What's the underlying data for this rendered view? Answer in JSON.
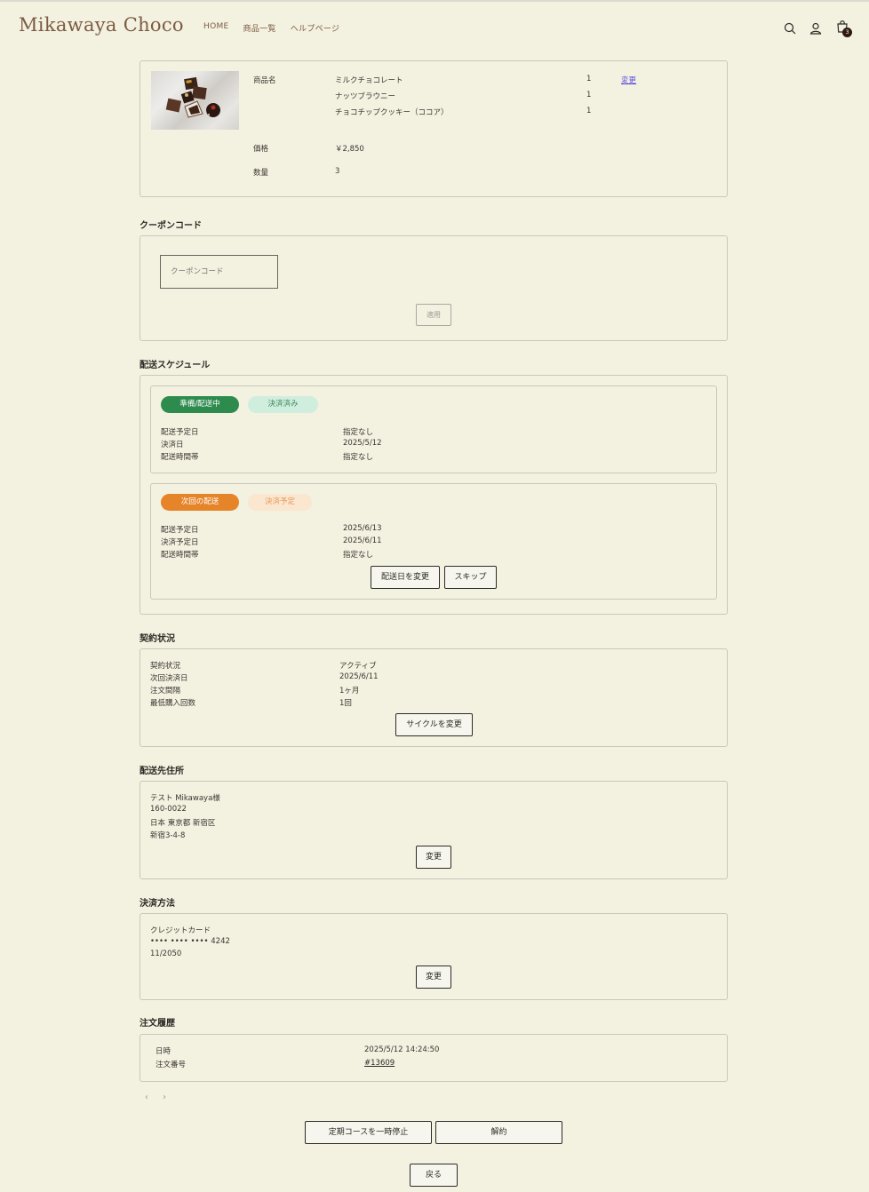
{
  "header": {
    "logo": "Mikawaya Choco",
    "nav": [
      "HOME",
      "商品一覧",
      "ヘルプページ"
    ],
    "cart_count": "3",
    "icons": [
      "search-icon",
      "user-icon",
      "cart-icon"
    ]
  },
  "product": {
    "name_label": "商品名",
    "items": [
      {
        "name": "ミルクチョコレート",
        "qty": "1"
      },
      {
        "name": "ナッツブラウニー",
        "qty": "1"
      },
      {
        "name": "チョコチップクッキー（ココア）",
        "qty": "1"
      }
    ],
    "change_link": "変更",
    "price_label": "価格",
    "price_value": "￥2,850",
    "quantity_label": "数量",
    "quantity_value": "3"
  },
  "coupon": {
    "title": "クーポンコード",
    "placeholder": "クーポンコード",
    "apply_label": "適用"
  },
  "schedule": {
    "title": "配送スケジュール",
    "current": {
      "status_badge": "準備/配送中",
      "payment_badge": "決済済み",
      "rows": [
        {
          "label": "配送予定日",
          "value": "指定なし"
        },
        {
          "label": "決済日",
          "value": "2025/5/12"
        },
        {
          "label": "配送時間帯",
          "value": "指定なし"
        }
      ]
    },
    "next": {
      "status_badge": "次回の配送",
      "payment_badge": "決済予定",
      "rows": [
        {
          "label": "配送予定日",
          "value": "2025/6/13"
        },
        {
          "label": "決済予定日",
          "value": "2025/6/11"
        },
        {
          "label": "配送時間帯",
          "value": "指定なし"
        }
      ],
      "change_date_label": "配送日を変更",
      "skip_label": "スキップ"
    }
  },
  "contract": {
    "title": "契約状況",
    "rows": [
      {
        "label": "契約状況",
        "value": "アクティブ"
      },
      {
        "label": "次回決済日",
        "value": "2025/6/11"
      },
      {
        "label": "注文間隔",
        "value": "1ヶ月"
      },
      {
        "label": "最低購入回数",
        "value": "1回"
      }
    ],
    "change_cycle_label": "サイクルを変更"
  },
  "address": {
    "title": "配送先住所",
    "lines": [
      "テスト Mikawaya様",
      "160-0022",
      "日本 東京都 新宿区",
      "新宿3-4-8"
    ],
    "change_label": "変更"
  },
  "payment": {
    "title": "決済方法",
    "lines": [
      "クレジットカード",
      "•••• •••• •••• 4242",
      "11/2050"
    ],
    "change_label": "変更"
  },
  "history": {
    "title": "注文履歴",
    "date_label": "日時",
    "date_value": "2025/5/12 14:24:50",
    "order_label": "注文番号",
    "order_value": "#13609",
    "prev": "‹",
    "next": "›"
  },
  "footer": {
    "pause_label": "定期コースを一時停止",
    "cancel_label": "解約",
    "back_label": "戻る"
  },
  "colors": {
    "background": "#f3f1e0",
    "brand": "#7d5b43",
    "green": "#2e8b4e",
    "green_light": "#cfeedd",
    "orange": "#e6842a",
    "orange_light": "#fbe6cf",
    "link": "#5a4ee0"
  }
}
